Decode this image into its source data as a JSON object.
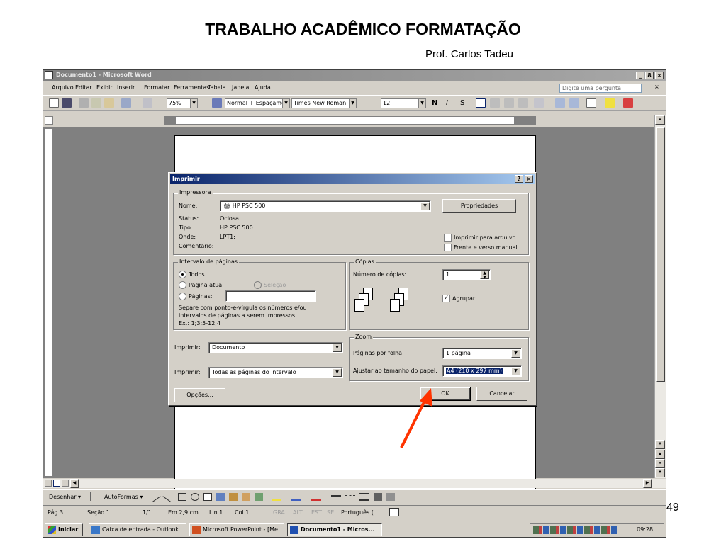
{
  "slide": {
    "title": "TRABALHO ACADÊMICO FORMATAÇÃO",
    "subtitle": "Prof. Carlos Tadeu",
    "page_number": "49"
  },
  "window": {
    "title": "Documento1 - Microsoft Word",
    "controls": [
      "_",
      "8",
      "×"
    ]
  },
  "menu": {
    "items": [
      "Arquivo",
      "Editar",
      "Exibir",
      "Inserir",
      "Formatar",
      "Ferramentas",
      "Tabela",
      "Janela",
      "Ajuda"
    ],
    "ask_placeholder": "Digite uma pergunta"
  },
  "toolbar": {
    "zoom": "75%",
    "style": "Normal + Espaçamei",
    "font": "Times New Roman",
    "size": "12",
    "bold": "N",
    "italic": "I",
    "underline": "S"
  },
  "print_dialog": {
    "title": "Imprimir",
    "help_btn": "?",
    "close_btn": "×",
    "printer_group": "Impressora",
    "name_label": "Nome:",
    "printer_name": "HP PSC 500",
    "properties_btn": "Propriedades",
    "status_label": "Status:",
    "status_value": "Ociosa",
    "type_label": "Tipo:",
    "type_value": "HP PSC 500",
    "where_label": "Onde:",
    "where_value": "LPT1:",
    "comment_label": "Comentário:",
    "print_to_file": "Imprimir para arquivo",
    "manual_duplex": "Frente e verso manual",
    "range_group": "Intervalo de páginas",
    "range_all": "Todos",
    "range_current": "Página atual",
    "range_selection": "Seleção",
    "range_pages": "Páginas:",
    "range_help_1": "Separe com ponto-e-vírgula os números e/ou",
    "range_help_2": "intervalos de páginas a serem impressos.",
    "range_help_3": "Ex.: 1;3;5-12;4",
    "copies_group": "Cópias",
    "copies_label": "Número de cópias:",
    "copies_value": "1",
    "collate": "Agrupar",
    "print_what_label": "Imprimir:",
    "print_what_value": "Documento",
    "print_label": "Imprimir:",
    "print_value": "Todas as páginas do intervalo",
    "zoom_group": "Zoom",
    "pages_per_sheet_label": "Páginas por folha:",
    "pages_per_sheet_value": "1 página",
    "scale_label": "Ajustar ao tamanho do papel:",
    "scale_value": "A4 (210 x 297 mm)",
    "options_btn": "Opções...",
    "ok_btn": "OK",
    "cancel_btn": "Cancelar"
  },
  "drawing_bar": {
    "draw": "Desenhar ▾",
    "autoshapes": "AutoFormas ▾"
  },
  "status": {
    "page": "Pág 3",
    "section": "Seção 1",
    "pages": "1/1",
    "position": "Em 2,9 cm",
    "line": "Lin 1",
    "col": "Col 1",
    "rec": "GRA",
    "trk": "ALT",
    "ext": "EST",
    "ovr": "SE",
    "language": "Português ("
  },
  "taskbar": {
    "start": "Iniciar",
    "tasks": [
      "Caixa de entrada - Outlook...",
      "Microsoft PowerPoint - [Me...",
      "Documento1 - Micros..."
    ],
    "clock": "09:28"
  },
  "colors": {
    "arrow": "#ff3300",
    "dialog_title": "#0a246a",
    "selection": "#0a246a"
  }
}
